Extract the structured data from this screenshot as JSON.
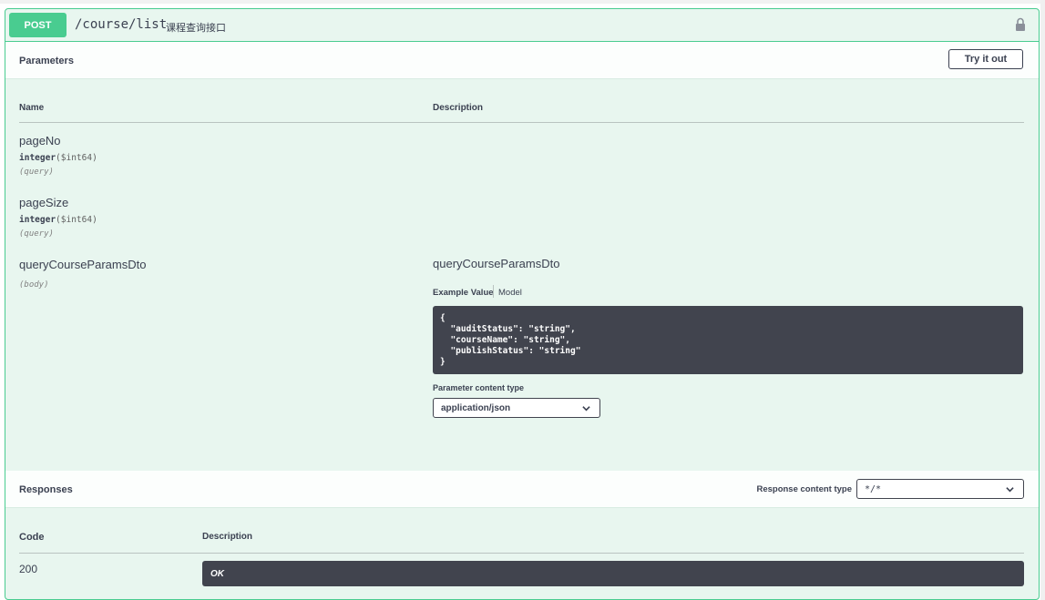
{
  "operation": {
    "method": "POST",
    "path": "/course/list",
    "summary": "课程查询接口"
  },
  "parameters": {
    "section_title": "Parameters",
    "try_it_out_label": "Try it out",
    "col_name": "Name",
    "col_description": "Description",
    "items": [
      {
        "name": "pageNo",
        "type": "integer",
        "format": "($int64)",
        "in": "(query)"
      },
      {
        "name": "pageSize",
        "type": "integer",
        "format": "($int64)",
        "in": "(query)"
      },
      {
        "name": "queryCourseParamsDto",
        "in": "(body)"
      }
    ],
    "body": {
      "schema_title": "queryCourseParamsDto",
      "tab_example": "Example Value",
      "tab_model": "Model",
      "example": "{\n  \"auditStatus\": \"string\",\n  \"courseName\": \"string\",\n  \"publishStatus\": \"string\"\n}",
      "content_type_label": "Parameter content type",
      "content_type_value": "application/json"
    }
  },
  "responses": {
    "section_title": "Responses",
    "content_type_label": "Response content type",
    "content_type_value": "*/*",
    "col_code": "Code",
    "col_description": "Description",
    "rows": [
      {
        "code": "200",
        "description": "OK"
      }
    ]
  },
  "colors": {
    "post_accent": "#49cc90",
    "background_tint": "#e8f6ef",
    "code_bg": "#41444e",
    "text": "#3b4151"
  },
  "icons": {
    "lock": "lock-icon",
    "chevron": "chevron-down-icon"
  }
}
